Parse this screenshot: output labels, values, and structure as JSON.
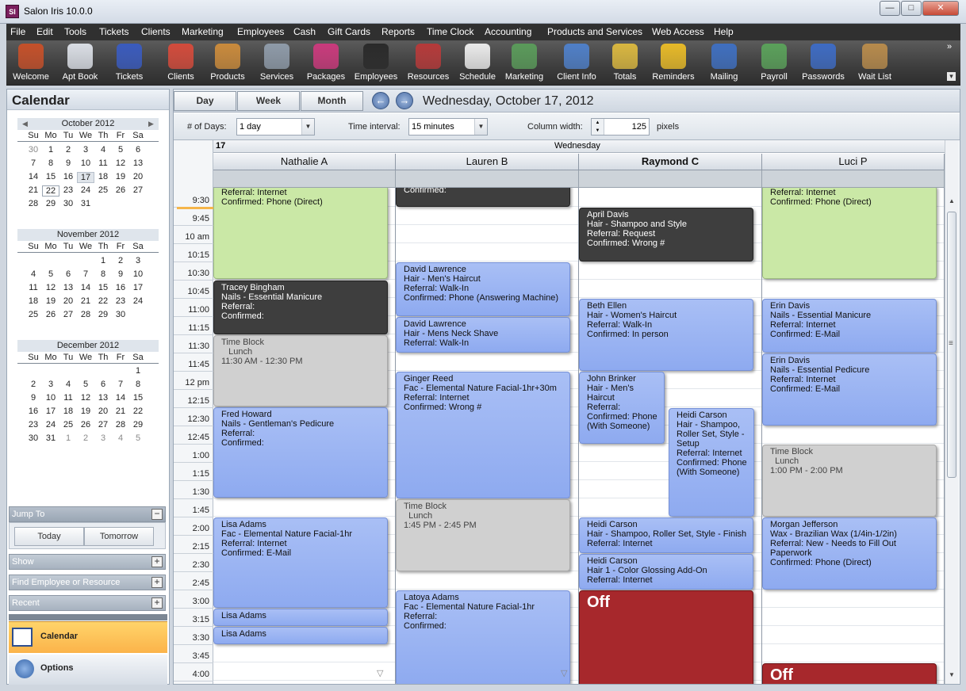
{
  "window": {
    "title": "Salon Iris 10.0.0",
    "icon_text": "SI",
    "minimize": "—",
    "maximize": "□",
    "close": "✕"
  },
  "menu": [
    "File",
    "Edit",
    "Tools",
    "Tickets",
    "Clients",
    "Marketing",
    "Employees",
    "Cash",
    "Gift Cards",
    "Reports",
    "Time Clock",
    "Accounting",
    "Products and Services",
    "Web Access",
    "Help"
  ],
  "toolbar": {
    "items": [
      {
        "label": "Welcome",
        "icon": "house-icon",
        "color": "#c4502a"
      },
      {
        "label": "Apt Book",
        "icon": "appointment-book-icon",
        "color": "#d9dde4"
      },
      {
        "label": "Tickets",
        "icon": "tickets-icon",
        "color": "#3a5bbd"
      },
      {
        "label": "Clients",
        "icon": "clients-icon",
        "color": "#d24b3c"
      },
      {
        "label": "Products",
        "icon": "shopping-bag-icon",
        "color": "#c98a3c"
      },
      {
        "label": "Services",
        "icon": "services-icon",
        "color": "#8e9aa8"
      },
      {
        "label": "Packages",
        "icon": "packages-icon",
        "color": "#c93a7c"
      },
      {
        "label": "Employees",
        "icon": "employee-icon",
        "color": "#2a2a2a"
      },
      {
        "label": "Resources",
        "icon": "resources-icon",
        "color": "#b53a3a"
      },
      {
        "label": "Schedule",
        "icon": "schedule-icon",
        "color": "#e9e9e9"
      },
      {
        "label": "Marketing",
        "icon": "marketing-icon",
        "color": "#5a9a5a"
      },
      {
        "label": "Client Info",
        "icon": "client-info-icon",
        "color": "#4f7fc7"
      },
      {
        "label": "Totals",
        "icon": "totals-icon",
        "color": "#d8b640"
      },
      {
        "label": "Reminders",
        "icon": "bell-icon",
        "color": "#e6b928"
      },
      {
        "label": "Mailing",
        "icon": "mailing-icon",
        "color": "#3f6fbf"
      },
      {
        "label": "Payroll",
        "icon": "payroll-icon",
        "color": "#5aa05a"
      },
      {
        "label": "Passwords",
        "icon": "shield-icon",
        "color": "#3e6bc2"
      },
      {
        "label": "Wait List",
        "icon": "hourglass-icon",
        "color": "#b68a4c"
      }
    ],
    "overflow": "»",
    "overflow_down": "▾"
  },
  "left": {
    "header": "Calendar",
    "prev": "◀",
    "next": "▶",
    "dow": [
      "Su",
      "Mo",
      "Tu",
      "We",
      "Th",
      "Fr",
      "Sa"
    ],
    "months": [
      {
        "title": "October 2012",
        "weeks": [
          [
            "30",
            "1",
            "2",
            "3",
            "4",
            "5",
            "6"
          ],
          [
            "7",
            "8",
            "9",
            "10",
            "11",
            "12",
            "13"
          ],
          [
            "14",
            "15",
            "16",
            "17",
            "18",
            "19",
            "20"
          ],
          [
            "21",
            "22",
            "23",
            "24",
            "25",
            "26",
            "27"
          ],
          [
            "28",
            "29",
            "30",
            "31",
            "",
            "",
            ""
          ]
        ],
        "other_first_row": [
          0
        ]
      },
      {
        "title": "November 2012",
        "weeks": [
          [
            "",
            "",
            "",
            "",
            "1",
            "2",
            "3"
          ],
          [
            "4",
            "5",
            "6",
            "7",
            "8",
            "9",
            "10"
          ],
          [
            "11",
            "12",
            "13",
            "14",
            "15",
            "16",
            "17"
          ],
          [
            "18",
            "19",
            "20",
            "21",
            "22",
            "23",
            "24"
          ],
          [
            "25",
            "26",
            "27",
            "28",
            "29",
            "30",
            ""
          ]
        ]
      },
      {
        "title": "December 2012",
        "weeks": [
          [
            "",
            "",
            "",
            "",
            "",
            "",
            "1"
          ],
          [
            "2",
            "3",
            "4",
            "5",
            "6",
            "7",
            "8"
          ],
          [
            "9",
            "10",
            "11",
            "12",
            "13",
            "14",
            "15"
          ],
          [
            "16",
            "17",
            "18",
            "19",
            "20",
            "21",
            "22"
          ],
          [
            "23",
            "24",
            "25",
            "26",
            "27",
            "28",
            "29"
          ],
          [
            "30",
            "31",
            "1",
            "2",
            "3",
            "4",
            "5"
          ]
        ]
      }
    ],
    "jump_to": "Jump To",
    "today": "Today",
    "tomorrow": "Tomorrow",
    "show": "Show",
    "find": "Find Employee or Resource",
    "recent": "Recent",
    "collapse": "−",
    "expand": "+",
    "nav_calendar": "Calendar",
    "nav_options": "Options"
  },
  "view": {
    "day": "Day",
    "week": "Week",
    "month": "Month",
    "prev": "←",
    "next": "→",
    "date": "Wednesday, October 17, 2012",
    "days_label": "# of Days:",
    "days_value": "1 day",
    "interval_label": "Time interval:",
    "interval_value": "15 minutes",
    "width_label": "Column width:",
    "width_value": "125",
    "width_unit": "pixels",
    "dropdown": "▼",
    "spin": "▲▼"
  },
  "grid": {
    "day_num": "17",
    "day_name": "Wednesday",
    "times": [
      "9:30",
      "9:45",
      "10 am",
      "10:15",
      "10:30",
      "10:45",
      "11:00",
      "11:15",
      "11:30",
      "11:45",
      "12 pm",
      "12:15",
      "12:30",
      "12:45",
      "1:00",
      "1:15",
      "1:30",
      "1:45",
      "2:00",
      "2:15",
      "2:30",
      "2:45",
      "3:00",
      "3:15",
      "3:30",
      "3:45",
      "4:00"
    ],
    "columns": [
      "Nathalie A",
      "Lauren B",
      "Raymond C",
      "Luci P"
    ],
    "more": "▽",
    "scroll_up": "▲",
    "scroll_down": "▼",
    "grip": "≡"
  },
  "appointments": {
    "nathalie": [
      {
        "lines": [
          "Referral: Internet",
          "Confirmed: Phone (Direct)"
        ]
      },
      {
        "lines": [
          "Tracey Bingham",
          "Nails - Essential Manicure",
          "Referral:",
          "Confirmed:"
        ]
      },
      {
        "lines": [
          "Time Block",
          "   Lunch",
          "11:30 AM - 12:30 PM"
        ]
      },
      {
        "lines": [
          "Fred Howard",
          "Nails - Gentleman's Pedicure",
          "Referral:",
          "Confirmed:"
        ]
      },
      {
        "lines": [
          "Lisa Adams",
          "Fac - Elemental Nature Facial-1hr",
          "Referral: Internet",
          "Confirmed: E-Mail"
        ]
      },
      {
        "lines": [
          "Lisa Adams"
        ]
      },
      {
        "lines": [
          "Lisa Adams"
        ]
      }
    ],
    "lauren": [
      {
        "lines": [
          "Confirmed:"
        ]
      },
      {
        "lines": [
          "David Lawrence",
          "Hair - Men's Haircut",
          "Referral: Walk-In",
          "Confirmed: Phone (Answering Machine)"
        ]
      },
      {
        "lines": [
          "David Lawrence",
          "Hair - Mens Neck Shave",
          "Referral: Walk-In"
        ]
      },
      {
        "lines": [
          "Ginger Reed",
          "Fac - Elemental Nature Facial-1hr+30m",
          "Referral: Internet",
          "Confirmed: Wrong #"
        ]
      },
      {
        "lines": [
          "Time Block",
          "  Lunch",
          "1:45 PM - 2:45 PM"
        ]
      },
      {
        "lines": [
          "Latoya Adams",
          "Fac - Elemental Nature Facial-1hr",
          "Referral:",
          "Confirmed:"
        ]
      }
    ],
    "raymond": [
      {
        "lines": [
          "April Davis",
          "Hair - Shampoo and Style",
          "Referral: Request",
          "Confirmed: Wrong #"
        ]
      },
      {
        "lines": [
          "Beth Ellen",
          "Hair - Women's Haircut",
          "Referral: Walk-In",
          "Confirmed: In person"
        ]
      },
      {
        "lines": [
          "John Brinker",
          "Hair - Men's",
          "Haircut",
          "Referral:",
          "Confirmed: Phone",
          "(With Someone)"
        ]
      },
      {
        "lines": [
          "Heidi Carson",
          "Hair - Shampoo,",
          "Roller Set, Style -",
          "Setup",
          "Referral: Internet",
          "Confirmed: Phone",
          "(With Someone)"
        ]
      },
      {
        "lines": [
          "Heidi Carson",
          "Hair - Shampoo, Roller Set, Style - Finish",
          "Referral: Internet"
        ]
      },
      {
        "lines": [
          "Heidi Carson",
          "Hair 1 - Color Glossing Add-On",
          "Referral: Internet"
        ]
      },
      {
        "lines": [
          "Off"
        ]
      }
    ],
    "luci": [
      {
        "lines": [
          "Referral: Internet",
          "Confirmed: Phone (Direct)"
        ]
      },
      {
        "lines": [
          "Erin Davis",
          "Nails - Essential Manicure",
          "Referral: Internet",
          "Confirmed: E-Mail"
        ]
      },
      {
        "lines": [
          "Erin Davis",
          "Nails - Essential Pedicure",
          "Referral: Internet",
          "Confirmed: E-Mail"
        ]
      },
      {
        "lines": [
          "Time Block",
          "  Lunch",
          "1:00 PM - 2:00 PM"
        ]
      },
      {
        "lines": [
          "Morgan Jefferson",
          "Wax - Brazilian Wax (1/4in-1/2in)",
          "Referral: New - Needs to Fill Out",
          "Paperwork",
          "Confirmed: Phone (Direct)"
        ]
      },
      {
        "lines": [
          "Off"
        ]
      }
    ]
  }
}
